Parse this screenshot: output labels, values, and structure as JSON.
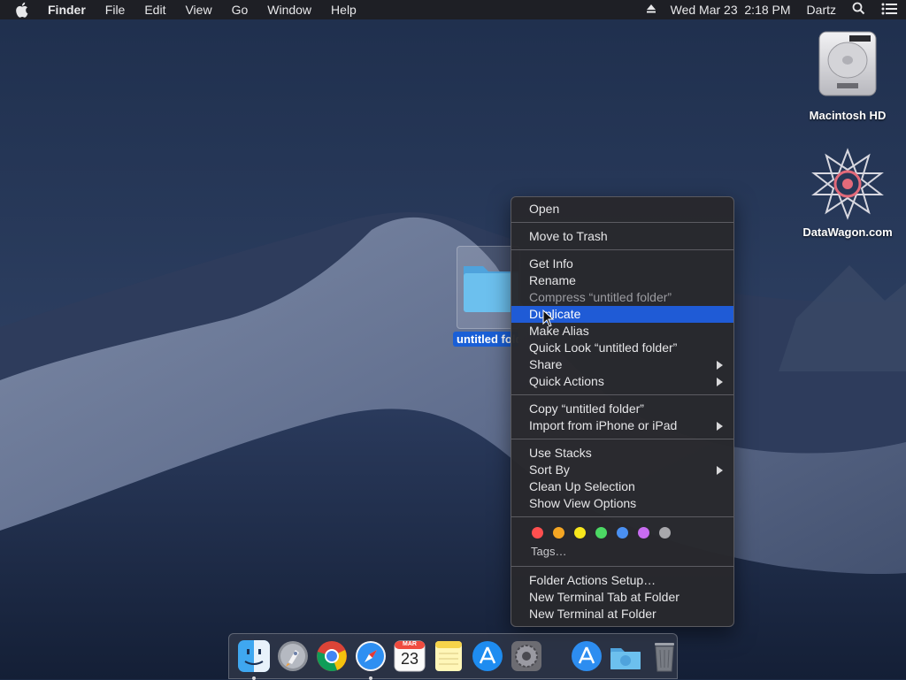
{
  "menubar": {
    "app_name": "Finder",
    "menus": [
      "File",
      "Edit",
      "View",
      "Go",
      "Window",
      "Help"
    ],
    "clock": "Wed Mar 23  2:18 PM",
    "user": "Dartz"
  },
  "desktop": {
    "icons": [
      {
        "label": "Macintosh HD",
        "icon": "hard-drive-icon"
      },
      {
        "label": "DataWagon.com",
        "icon": "star-logo-icon"
      }
    ],
    "selected_folder": {
      "label": "untitled folder"
    }
  },
  "context_menu": {
    "groups": [
      [
        {
          "label": "Open"
        }
      ],
      [
        {
          "label": "Move to Trash"
        }
      ],
      [
        {
          "label": "Get Info"
        },
        {
          "label": "Rename"
        },
        {
          "label": "Compress “untitled folder”",
          "disabled": true
        },
        {
          "label": "Duplicate",
          "highlighted": true
        },
        {
          "label": "Make Alias"
        },
        {
          "label": "Quick Look “untitled folder”"
        },
        {
          "label": "Share",
          "submenu": true
        },
        {
          "label": "Quick Actions",
          "submenu": true
        }
      ],
      [
        {
          "label": "Copy “untitled folder”"
        },
        {
          "label": "Import from iPhone or iPad",
          "submenu": true
        }
      ],
      [
        {
          "label": "Use Stacks"
        },
        {
          "label": "Sort By",
          "submenu": true
        },
        {
          "label": "Clean Up Selection"
        },
        {
          "label": "Show View Options"
        }
      ]
    ],
    "tag_colors": [
      "#ff4f4f",
      "#f5a623",
      "#f8e71c",
      "#4cd964",
      "#4a90f2",
      "#c86cf0",
      "#a8a8ac"
    ],
    "tags_label": "Tags…",
    "bottom_group": [
      {
        "label": "Folder Actions Setup…"
      },
      {
        "label": "New Terminal Tab at Folder"
      },
      {
        "label": "New Terminal at Folder"
      }
    ]
  },
  "dock": {
    "apps": [
      {
        "name": "finder-icon",
        "running": true
      },
      {
        "name": "launchpad-icon",
        "running": false
      },
      {
        "name": "chrome-icon",
        "running": false
      },
      {
        "name": "safari-icon",
        "running": true
      },
      {
        "name": "calendar-icon",
        "running": false,
        "month": "MAR",
        "day": "23"
      },
      {
        "name": "notes-icon",
        "running": false
      },
      {
        "name": "app-store-icon",
        "running": false
      },
      {
        "name": "system-preferences-icon",
        "running": false
      }
    ],
    "right": [
      {
        "name": "applications-folder-icon"
      },
      {
        "name": "downloads-folder-icon"
      },
      {
        "name": "trash-icon"
      }
    ]
  },
  "colors": {
    "menu_highlight": "#1f5bd6",
    "selection_label": "#1a5fd6"
  }
}
